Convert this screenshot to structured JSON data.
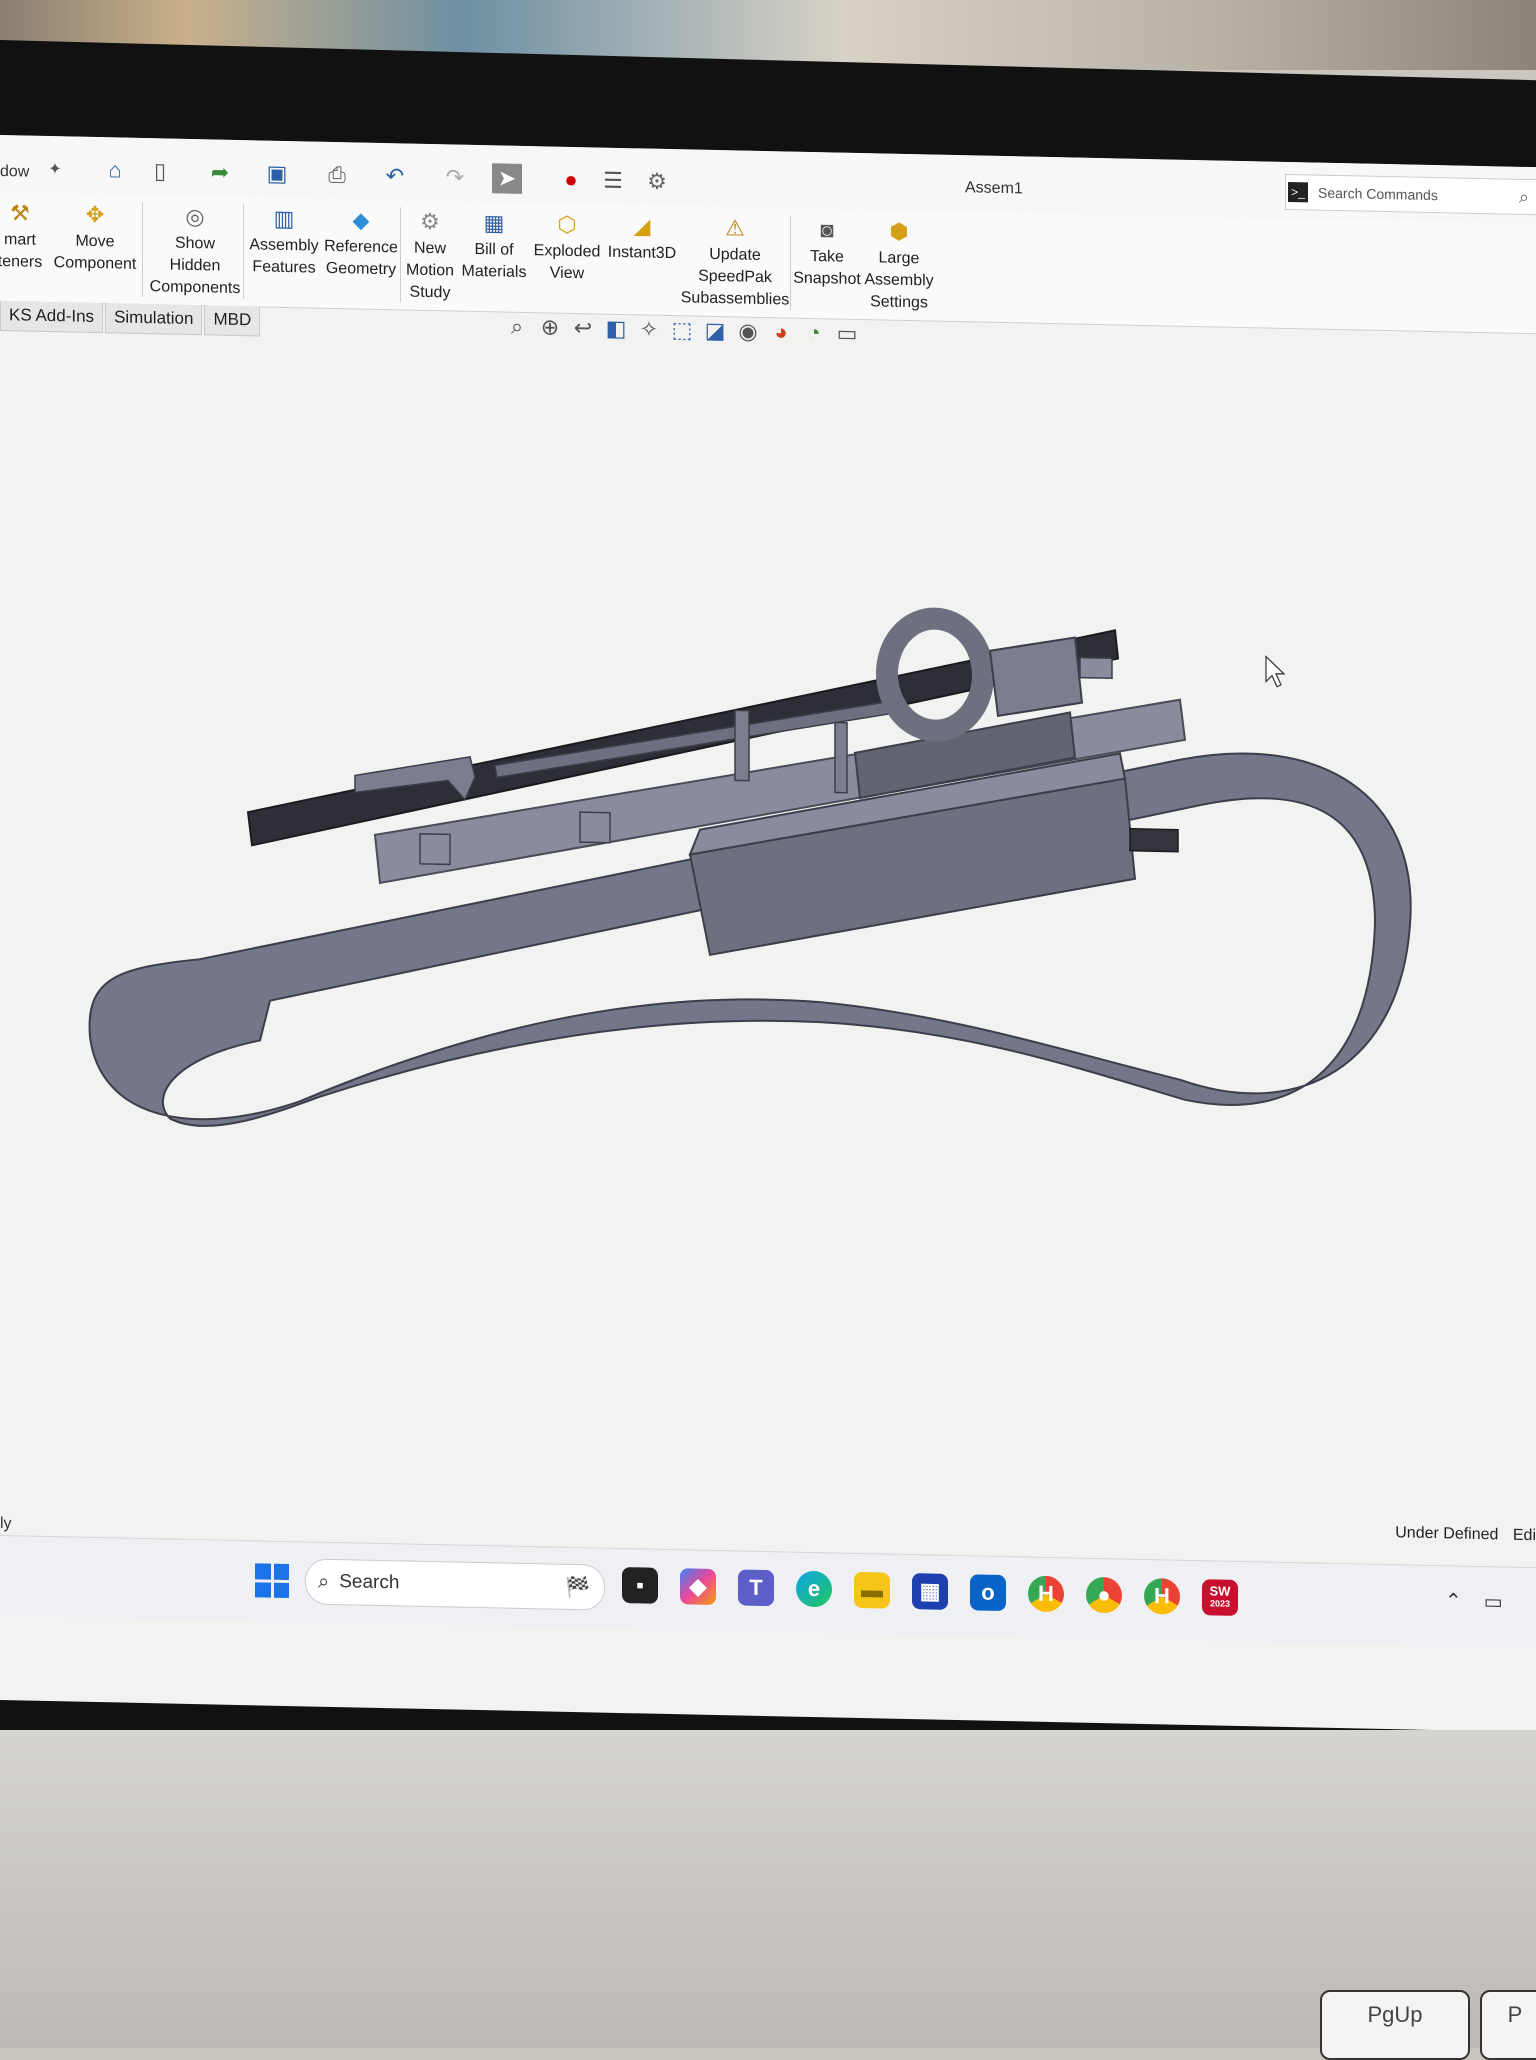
{
  "window": {
    "title": "Assem1",
    "partial_left_label": "dow",
    "search_placeholder": "Search Commands"
  },
  "quick_access": [
    "home-icon",
    "new-document-icon",
    "open-icon",
    "save-icon",
    "print-icon",
    "undo-icon",
    "redo-icon",
    "select-pointer-icon",
    "rebuild-icon",
    "file-properties-icon",
    "options-gear-icon"
  ],
  "ribbon": {
    "buttons": [
      {
        "label": "mart\nteners",
        "icon": "smart-fasteners-icon"
      },
      {
        "label": "Move\nComponent",
        "icon": "move-component-icon"
      },
      {
        "label": "Show\nHidden\nComponents",
        "icon": "show-hidden-icon"
      },
      {
        "label": "Assembly\nFeatures",
        "icon": "assembly-features-icon"
      },
      {
        "label": "Reference\nGeometry",
        "icon": "reference-geometry-icon"
      },
      {
        "label": "New\nMotion\nStudy",
        "icon": "motion-study-icon"
      },
      {
        "label": "Bill of\nMaterials",
        "icon": "bom-icon"
      },
      {
        "label": "Exploded\nView",
        "icon": "exploded-view-icon"
      },
      {
        "label": "Instant3D",
        "icon": "instant3d-icon"
      },
      {
        "label": "Update\nSpeedPak\nSubassemblies",
        "icon": "speedpak-icon"
      },
      {
        "label": "Take\nSnapshot",
        "icon": "camera-icon"
      },
      {
        "label": "Large\nAssembly\nSettings",
        "icon": "large-assembly-icon"
      }
    ]
  },
  "tabs": [
    "KS Add-Ins",
    "Simulation",
    "MBD"
  ],
  "status": {
    "text": "Under Defined",
    "partial": "Edi"
  },
  "left_edge_status": "ly",
  "taskbar": {
    "search_label": "Search",
    "apps": [
      "file-explorer-dark-icon",
      "copilot-icon",
      "teams-icon",
      "edge-icon",
      "folder-icon",
      "store-icon",
      "outlook-icon",
      "chrome-profile-h-icon",
      "chrome-profile-photo-icon",
      "chrome-profile-h2-icon",
      "solidworks-2023-icon"
    ],
    "solidworks_badge": "SW",
    "solidworks_year": "2023"
  },
  "keyboard": {
    "visible_key": "PgUp",
    "partial_key": "P"
  },
  "colors": {
    "model": "#6e7080",
    "model_dark": "#4a4c58",
    "belt": "#7a7c8e",
    "background": "#f2f2f0",
    "accent": "#1a73e8"
  }
}
